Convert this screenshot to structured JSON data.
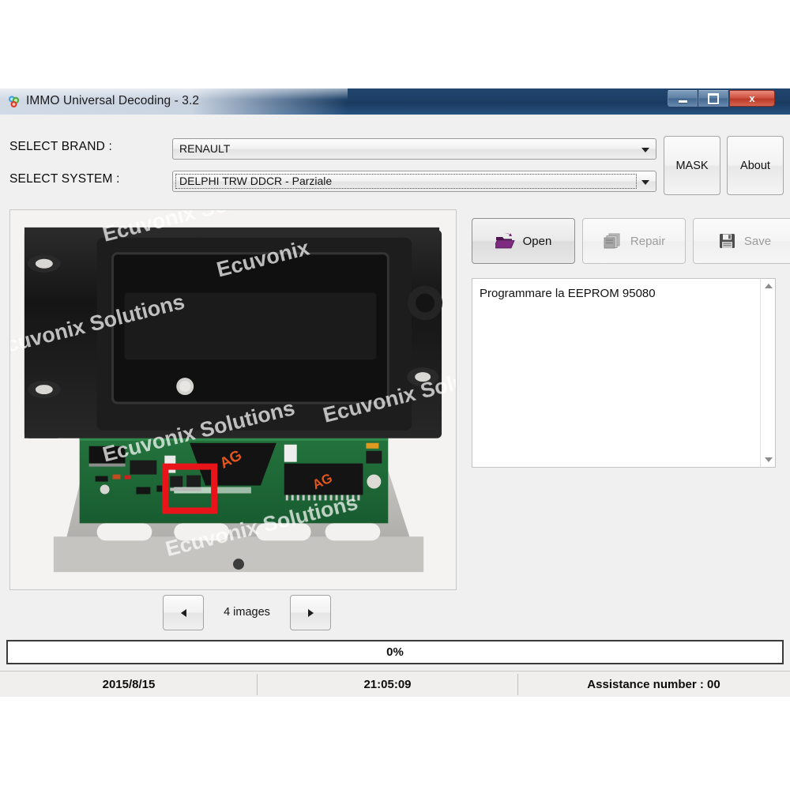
{
  "window": {
    "title": "IMMO Universal Decoding - 3.2",
    "app_icon": "immo-app-icon",
    "minimize_label": "",
    "maximize_label": "",
    "close_label": "x"
  },
  "selectors": {
    "brand_label": "SELECT BRAND :",
    "brand_value": "RENAULT",
    "system_label": "SELECT SYSTEM :",
    "system_value": "DELPHI TRW DDCR - Parziale"
  },
  "top_buttons": {
    "mask": "MASK",
    "about": "About"
  },
  "actions": {
    "open": "Open",
    "repair": "Repair",
    "save": "Save"
  },
  "image_viewer": {
    "count_label": "4 images",
    "prev_label": "",
    "next_label": "",
    "watermark": "Ecuvonix Solutions",
    "chip_marking": "AG"
  },
  "message": {
    "text": "Programmare la EEPROM 95080"
  },
  "progress": {
    "percent_label": "0%",
    "percent_value": 0
  },
  "status": {
    "date": "2015/8/15",
    "time": "21:05:09",
    "assistance": "Assistance number : 00"
  },
  "colors": {
    "titlebar_blue": "#1d3f66",
    "close_red": "#bb3a28",
    "highlight_red": "#e8141a",
    "pcb_green": "#1f6a38",
    "accent_orange": "#e8541c"
  }
}
